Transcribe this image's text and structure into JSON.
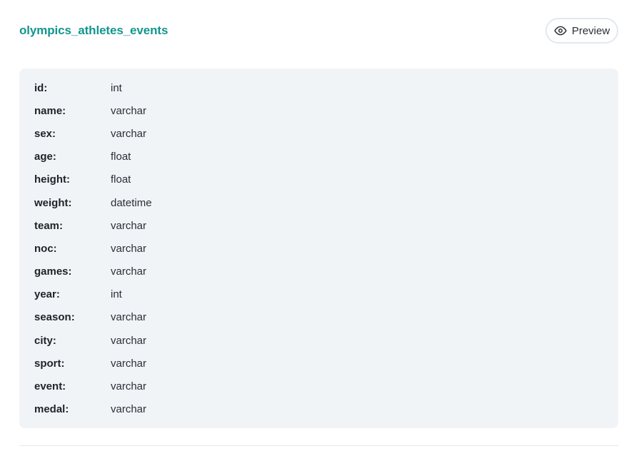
{
  "table": {
    "title": "olympics_athletes_events",
    "preview_label": "Preview",
    "preview_icon": "eye-icon",
    "title_color": "#12968c",
    "columns": [
      {
        "name": "id:",
        "type": "int"
      },
      {
        "name": "name:",
        "type": "varchar"
      },
      {
        "name": "sex:",
        "type": "varchar"
      },
      {
        "name": "age:",
        "type": "float"
      },
      {
        "name": "height:",
        "type": "float"
      },
      {
        "name": "weight:",
        "type": "datetime"
      },
      {
        "name": "team:",
        "type": "varchar"
      },
      {
        "name": "noc:",
        "type": "varchar"
      },
      {
        "name": "games:",
        "type": "varchar"
      },
      {
        "name": "year:",
        "type": "int"
      },
      {
        "name": "season:",
        "type": "varchar"
      },
      {
        "name": "city:",
        "type": "varchar"
      },
      {
        "name": "sport:",
        "type": "varchar"
      },
      {
        "name": "event:",
        "type": "varchar"
      },
      {
        "name": "medal:",
        "type": "varchar"
      }
    ]
  }
}
